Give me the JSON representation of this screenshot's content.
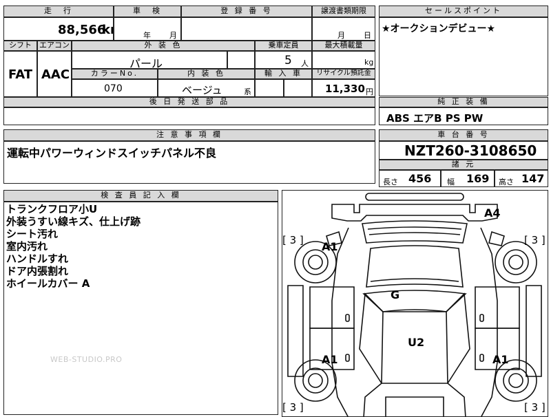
{
  "top": {
    "headers": {
      "mileage": "走　行",
      "inspection": "車　検",
      "registration": "登 録 番 号",
      "transfer_deadline": "譲渡書類期限",
      "sales_point": "セールスポイント"
    },
    "mileage": "88,566",
    "mileage_unit": "km",
    "inspection_year_label": "年",
    "inspection_month_label": "月",
    "transfer_month_label": "月",
    "transfer_day_label": "日",
    "sales_point_text": "★オークションデビュー★"
  },
  "spec": {
    "headers": {
      "shift": "シフト",
      "aircon": "エアコン",
      "exterior_color": "外 装 色",
      "capacity": "乗車定員",
      "max_load": "最大積載量",
      "color_no": "カラーNo.",
      "interior_color": "内 装 色",
      "import": "輸 入 車",
      "recycle": "リサイクル預託金"
    },
    "shift": "FAT",
    "aircon": "AAC",
    "exterior_color": "パール",
    "capacity": "5",
    "capacity_unit": "人",
    "max_load_unit": "kg",
    "color_no": "070",
    "interior_color": "ベージュ",
    "interior_suffix": "系",
    "recycle_fee": "11,330",
    "recycle_unit": "円"
  },
  "parts": {
    "header": "後 日 発 送 部 品"
  },
  "equipment": {
    "header": "純 正 装 備",
    "text": "ABS エアB PS PW"
  },
  "notes": {
    "header": "注 意 事 項 欄",
    "text": "運転中パワーウィンドスイッチパネル不良"
  },
  "chassis": {
    "header": "車 台 番 号",
    "number": "NZT260-3108650",
    "dims_header": "諸 元",
    "length_label": "長さ",
    "length": "456",
    "width_label": "幅",
    "width": "169",
    "height_label": "高さ",
    "height": "147"
  },
  "inspector": {
    "header": "検 査 員 記 入 欄",
    "lines": [
      "トランクフロア小U",
      "外装うすい線キズ、仕上げ跡",
      "シート汚れ",
      "室内汚れ",
      "ハンドルすれ",
      "ドア内張割れ",
      "ホイールカバー A"
    ],
    "watermark": "WEB-STUDIO.PRO"
  },
  "diagram": {
    "marks": {
      "a4": "A4",
      "a1_front": "A1",
      "g": "G",
      "u2": "U2",
      "a1_rear_left": "A1",
      "a1_rear_right": "A1"
    },
    "tire_brackets": {
      "front_left": "[ 3 ]",
      "front_right": "[ 3 ]",
      "rear_left": "[ 3 ]",
      "rear_right": "[ 3 ]"
    }
  }
}
